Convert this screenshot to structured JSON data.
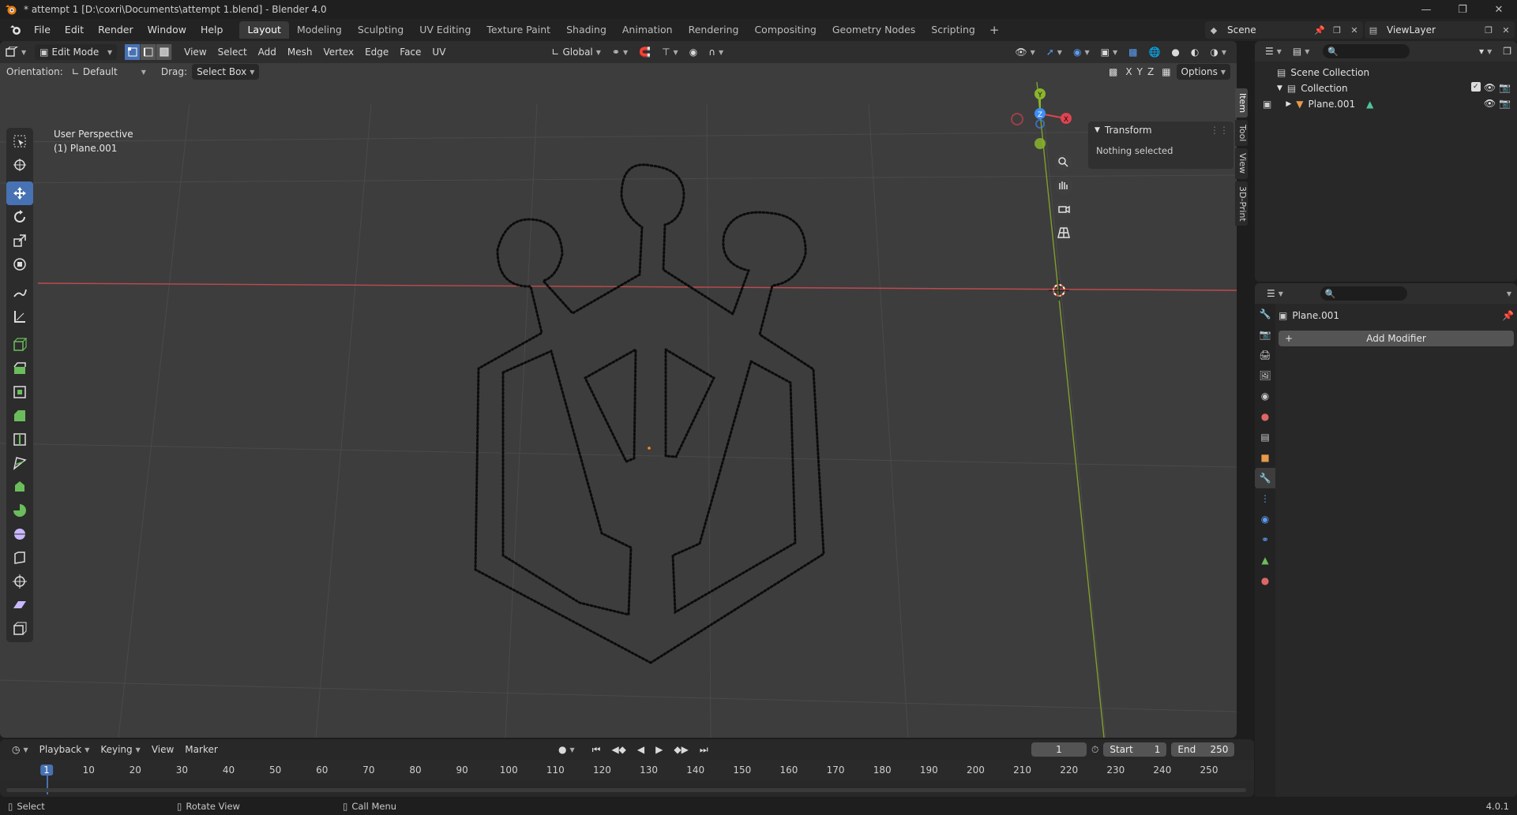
{
  "window": {
    "title": "* attempt 1 [D:\\coxri\\Documents\\attempt 1.blend] - Blender 4.0",
    "controls": [
      "minimize-icon",
      "maximize-icon",
      "close-icon"
    ]
  },
  "menubar": {
    "menus": [
      "File",
      "Edit",
      "Render",
      "Window",
      "Help"
    ],
    "workspaces": [
      "Layout",
      "Modeling",
      "Sculpting",
      "UV Editing",
      "Texture Paint",
      "Shading",
      "Animation",
      "Rendering",
      "Compositing",
      "Geometry Nodes",
      "Scripting"
    ],
    "active_workspace": "Layout",
    "scene": "Scene",
    "view_layer": "ViewLayer"
  },
  "viewport_header": {
    "mode": "Edit Mode",
    "menus": [
      "View",
      "Select",
      "Add",
      "Mesh",
      "Vertex",
      "Edge",
      "Face",
      "UV"
    ],
    "transform_orientation": "Global"
  },
  "tool_header": {
    "orientation_label": "Orientation:",
    "orientation_value": "Default",
    "drag_label": "Drag:",
    "drag_value": "Select Box",
    "axes": [
      "X",
      "Y",
      "Z"
    ],
    "options_label": "Options"
  },
  "viewport": {
    "view_name": "User Perspective",
    "object_label": "(1) Plane.001",
    "gizmo_axes": [
      "Y",
      "Z",
      "X"
    ]
  },
  "npanel": {
    "section": "Transform",
    "message": "Nothing selected",
    "tabs": [
      "Item",
      "Tool",
      "View",
      "3D-Print"
    ],
    "active_tab": "Item"
  },
  "outliner": {
    "rows": [
      {
        "label": "Scene Collection",
        "icon": "scene-collection-icon"
      },
      {
        "label": "Collection",
        "icon": "collection-icon"
      },
      {
        "label": "Plane.001",
        "icon": "mesh-object-icon"
      }
    ]
  },
  "properties": {
    "object_name": "Plane.001",
    "add_modifier_label": "Add Modifier",
    "tabs": [
      "tool-icon",
      "render-icon",
      "output-icon",
      "view-layer-icon",
      "scene-icon",
      "world-icon",
      "collection-icon",
      "object-icon",
      "modifier-icon",
      "particles-icon",
      "physics-icon",
      "constraints-icon",
      "data-icon",
      "material-icon"
    ],
    "active_tab": "modifier-icon"
  },
  "timeline": {
    "menus": [
      "Playback",
      "Keying",
      "View",
      "Marker"
    ],
    "current_frame": "1",
    "start_label": "Start",
    "start_value": "1",
    "end_label": "End",
    "end_value": "250",
    "ruler": [
      "1",
      "10",
      "20",
      "30",
      "40",
      "50",
      "60",
      "70",
      "80",
      "90",
      "100",
      "110",
      "120",
      "130",
      "140",
      "150",
      "160",
      "170",
      "180",
      "190",
      "200",
      "210",
      "220",
      "230",
      "240",
      "250"
    ]
  },
  "statusbar": {
    "select": "Select",
    "rotate": "Rotate View",
    "call_menu": "Call Menu",
    "version": "4.0.1"
  },
  "colors": {
    "accent": "#4772b3",
    "x_axis": "#e0434f",
    "y_axis": "#8ab52c",
    "z_axis": "#3d8ef5",
    "viewport_bg": "#3d3d3d"
  }
}
